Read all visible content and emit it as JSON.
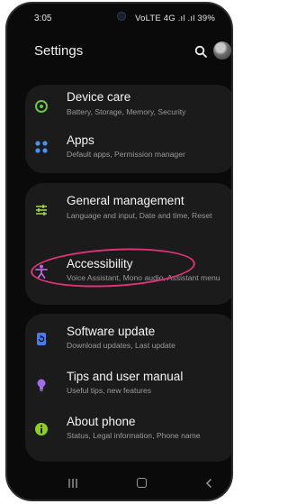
{
  "status": {
    "time": "3:05",
    "indicators": "VoLTE 4G .ıl .ıl 39%",
    "battery_icon": "battery-icon"
  },
  "header": {
    "title": "Settings"
  },
  "groups": [
    {
      "items": [
        {
          "label": "Device care",
          "subtitle": "Battery, Storage, Memory, Security",
          "icon": "device-care-icon",
          "color": "#6cc24a"
        }
      ]
    },
    {
      "items": [
        {
          "label": "Apps",
          "subtitle": "Default apps, Permission manager",
          "icon": "apps-icon",
          "color": "#4a90f5"
        }
      ]
    },
    {
      "items": [
        {
          "label": "General management",
          "subtitle": "Language and input, Date and time, Reset",
          "icon": "sliders-icon",
          "color": "#9bd24a"
        },
        {
          "label": "Accessibility",
          "subtitle": "Voice Assistant, Mono audio, Assistant menu",
          "icon": "accessibility-icon",
          "color": "#b86ae0"
        }
      ]
    },
    {
      "items": [
        {
          "label": "Software update",
          "subtitle": "Download updates, Last update",
          "icon": "software-update-icon",
          "color": "#4a7cf0"
        },
        {
          "label": "Tips and user manual",
          "subtitle": "Useful tips, new features",
          "icon": "lightbulb-icon",
          "color": "#a36be8"
        },
        {
          "label": "About phone",
          "subtitle": "Status, Legal information, Phone name",
          "icon": "info-icon",
          "color": "#8fd01f"
        }
      ]
    }
  ],
  "annotation": {
    "color": "#e0327a"
  }
}
